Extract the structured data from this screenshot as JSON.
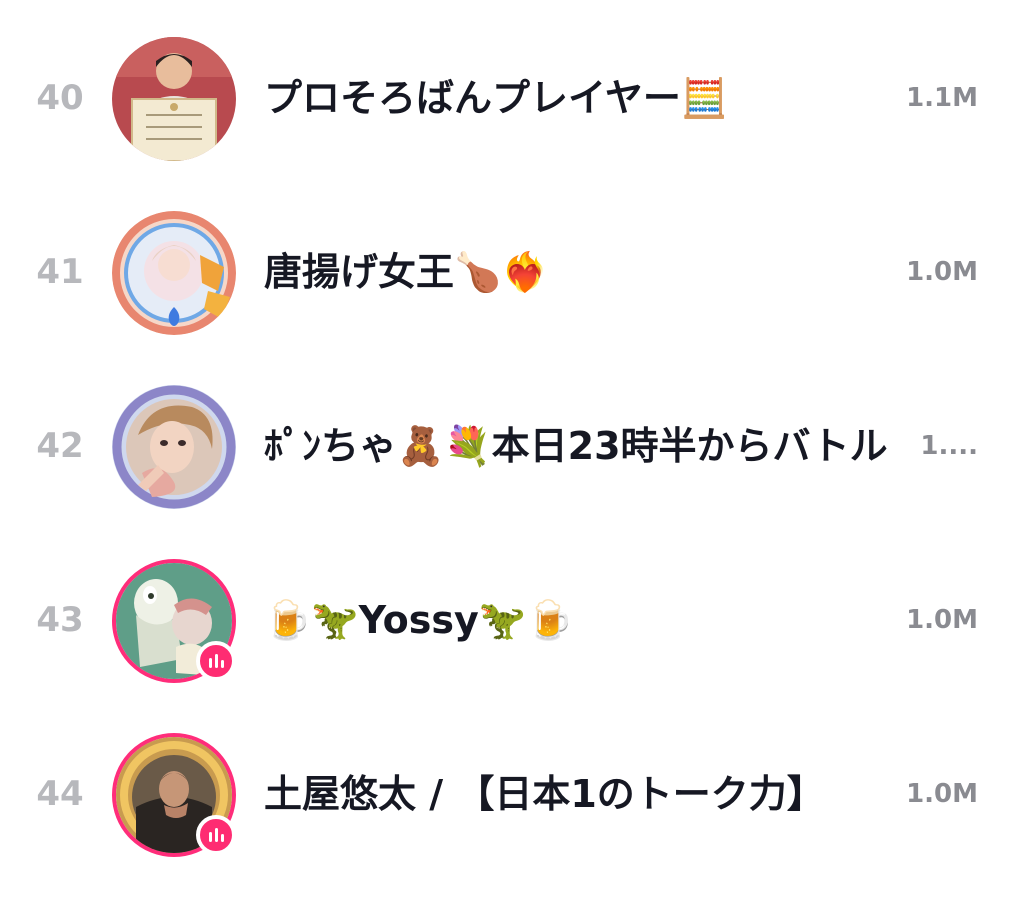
{
  "rows": [
    {
      "rank": "40",
      "name": "プロそろばんプレイヤー🧮",
      "count": "1.1M",
      "live": false
    },
    {
      "rank": "41",
      "name": "唐揚げ女王🍗❤️‍🔥",
      "count": "1.0M",
      "live": false
    },
    {
      "rank": "42",
      "name": "ﾎﾟﾝちゃ🧸💐本日23時半からバトル",
      "count": "1....",
      "live": false
    },
    {
      "rank": "43",
      "name": "🍺🦖Yossy🦖🍺",
      "count": "1.0M",
      "live": true
    },
    {
      "rank": "44",
      "name": "土屋悠太 / 【日本1のトーク力】",
      "count": "1.0M",
      "live": true
    }
  ],
  "colors": {
    "rank": "#b7b8bc",
    "name": "#161823",
    "count": "#8a8b91",
    "live_accent": "#fe2c72"
  }
}
